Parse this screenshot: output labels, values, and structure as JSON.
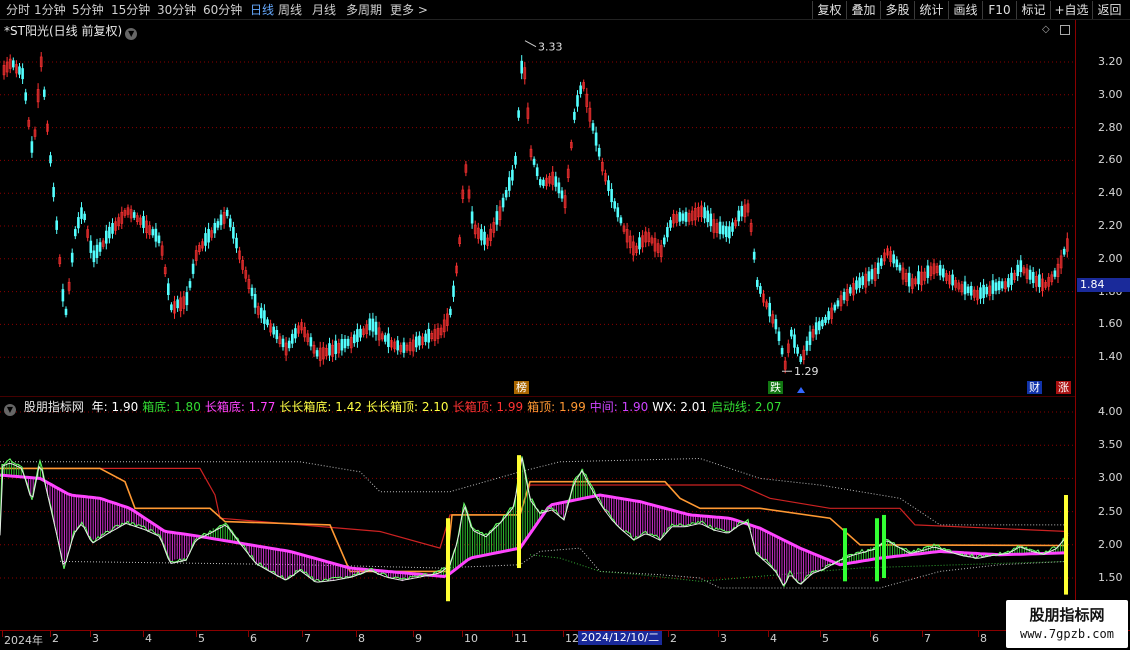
{
  "toolbar": {
    "periods": [
      "分时",
      "1分钟",
      "5分钟",
      "15分钟",
      "30分钟",
      "60分钟",
      "日线",
      "周线",
      "月线",
      "多周期",
      "更多 >"
    ],
    "buttons": [
      "复权",
      "叠加",
      "多股",
      "统计",
      "画线",
      "F10",
      "标记",
      "+自选",
      "返回"
    ]
  },
  "main": {
    "title": "*ST阳光(日线 前复权)",
    "high_label": "3.33",
    "low_label": "1.29",
    "current_price": "1.84",
    "y_ticks": [
      "3.20",
      "3.00",
      "2.80",
      "2.60",
      "2.40",
      "2.20",
      "2.00",
      "1.80",
      "1.60",
      "1.40"
    ],
    "signals": [
      "榜",
      "跌",
      "财",
      "涨"
    ]
  },
  "indicator": {
    "name": "股朋指标网",
    "values": [
      {
        "label": "年:",
        "value": "1.90",
        "color": "#ffffff"
      },
      {
        "label": "箱底:",
        "value": "1.80",
        "color": "#33dd33"
      },
      {
        "label": "长箱底:",
        "value": "1.77",
        "color": "#ff44ff"
      },
      {
        "label": "长长箱底:",
        "value": "1.42",
        "color": "#ffff44"
      },
      {
        "label": "长长箱顶:",
        "value": "2.10",
        "color": "#ffff44"
      },
      {
        "label": "长箱顶:",
        "value": "1.99",
        "color": "#ff3333"
      },
      {
        "label": "箱顶:",
        "value": "1.99",
        "color": "#ff9933"
      },
      {
        "label": "中间:",
        "value": "1.90",
        "color": "#cc44ff"
      },
      {
        "label": "WX:",
        "value": "2.01",
        "color": "#ffffff"
      },
      {
        "label": "启动线:",
        "value": "2.07",
        "color": "#33dd33"
      }
    ],
    "y_ticks": [
      "4.00",
      "3.50",
      "3.00",
      "2.50",
      "2.00",
      "1.50"
    ]
  },
  "date_axis": {
    "ticks": [
      "2024年",
      "2",
      "3",
      "4",
      "5",
      "6",
      "7",
      "8",
      "9",
      "10",
      "11",
      "12",
      "2",
      "3",
      "4",
      "5",
      "6",
      "7",
      "8"
    ],
    "cursor_date": "2024/12/10/二"
  },
  "colors": {
    "up": "#ff3232",
    "down": "#54ffff",
    "grid": "#8b0000",
    "box_top": "#ff9933",
    "long_box_top": "#ff3333",
    "long_box_bottom": "#ff44ff"
  },
  "watermark": {
    "line1": "股朋指标网",
    "line2": "www.7gpzb.com"
  }
}
